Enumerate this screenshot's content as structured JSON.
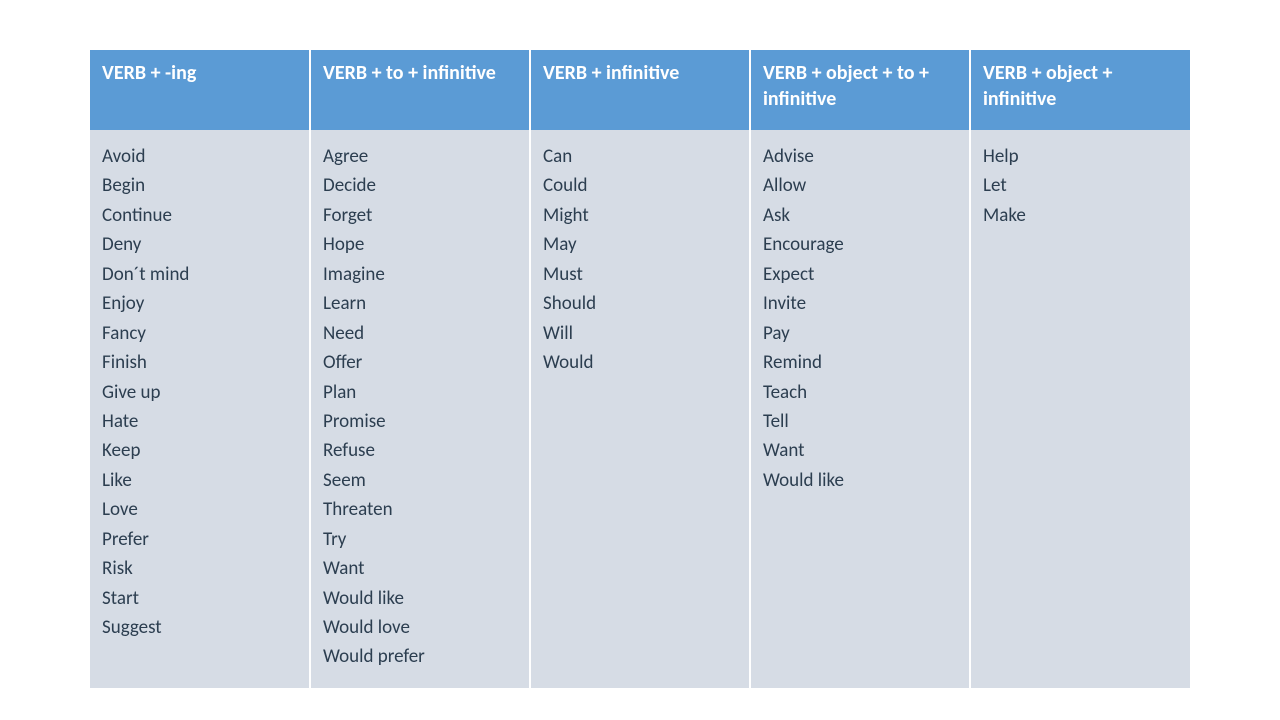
{
  "chart_data": {
    "type": "table",
    "columns": [
      {
        "header": "VERB + -ing",
        "items": [
          "avoid",
          "begin",
          "continue",
          "deny",
          "don´t mind",
          "enjoy",
          "fancy",
          "finish",
          "give up",
          "hate",
          "keep",
          "like",
          "love",
          "prefer",
          "risk",
          "start",
          "suggest"
        ]
      },
      {
        "header": "VERB + to + infinitive",
        "items": [
          "agree",
          "decide",
          "forget",
          "hope",
          "imagine",
          "learn",
          "need",
          "offer",
          "plan",
          "promise",
          "refuse",
          "seem",
          "threaten",
          "try",
          "want",
          "would like",
          "would love",
          "would prefer"
        ]
      },
      {
        "header": "VERB + infinitive",
        "items": [
          "can",
          "could",
          "might",
          "may",
          "must",
          "should",
          "will",
          "would"
        ]
      },
      {
        "header": "VERB + object + to + infinitive",
        "items": [
          "advise",
          "allow",
          "ask",
          "encourage",
          "expect",
          "invite",
          "pay",
          "remind",
          "teach",
          "tell",
          "want",
          "would like"
        ]
      },
      {
        "header": "VERB + object + infinitive",
        "items": [
          "help",
          "let",
          "make"
        ]
      }
    ]
  }
}
